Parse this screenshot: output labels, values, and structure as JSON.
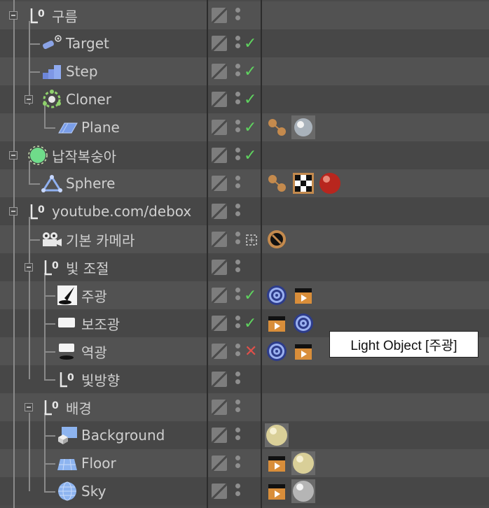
{
  "object_manager": {
    "rows": [
      {
        "label": "구름",
        "icon": "null-object-icon",
        "expanded": true,
        "check": false,
        "tags": []
      },
      {
        "label": "Target",
        "icon": "target-camera-icon",
        "check": true,
        "tags": []
      },
      {
        "label": "Step",
        "icon": "step-effector-icon",
        "check": true,
        "tags": []
      },
      {
        "label": "Cloner",
        "icon": "cloner-icon",
        "expanded": true,
        "check": true,
        "tags": []
      },
      {
        "label": "Plane",
        "icon": "plane-icon",
        "check": true,
        "tags": [
          "phong-tag-icon",
          "glass-material-icon"
        ]
      },
      {
        "label": "납작복숭아",
        "icon": "sphere-object-icon",
        "expanded": true,
        "check": true,
        "tags": []
      },
      {
        "label": "Sphere",
        "icon": "sphere-primitive-icon",
        "check": false,
        "tags": [
          "phong-tag-icon",
          "checker-material-icon",
          "red-material-icon"
        ]
      },
      {
        "label": "youtube.com/debox",
        "icon": "null-object-icon",
        "expanded": true,
        "check": false,
        "tags": []
      },
      {
        "label": "기본 카메라",
        "icon": "camera-icon",
        "check": false,
        "tags": [
          "protection-tag-icon"
        ]
      },
      {
        "label": "빛 조절",
        "icon": "null-object-icon",
        "expanded": true,
        "check": false,
        "tags": []
      },
      {
        "label": "주광",
        "icon": "spot-light-icon",
        "check": true,
        "tags": [
          "target-tag-icon",
          "clapper-tag-icon"
        ]
      },
      {
        "label": "보조광",
        "icon": "area-light-icon",
        "check": true,
        "tags": [
          "clapper-tag-icon",
          "target-tag-icon"
        ]
      },
      {
        "label": "역광",
        "icon": "area-light-icon",
        "cross": true,
        "tags": [
          "target-tag-icon",
          "clapper-tag-icon"
        ]
      },
      {
        "label": "빛방향",
        "icon": "null-object-icon",
        "check": false,
        "tags": []
      },
      {
        "label": "배경",
        "icon": "null-object-icon",
        "expanded": true,
        "check": false,
        "tags": []
      },
      {
        "label": "Background",
        "icon": "background-object-icon",
        "check": false,
        "tags": [
          "cream-material-icon"
        ]
      },
      {
        "label": "Floor",
        "icon": "floor-object-icon",
        "check": false,
        "tags": [
          "clapper-tag-icon",
          "cream-material-icon"
        ]
      },
      {
        "label": "Sky",
        "icon": "sky-object-icon",
        "check": false,
        "tags": [
          "clapper-tag-icon",
          "silver-material-icon"
        ]
      }
    ],
    "tooltip": "Light Object [주광]"
  }
}
